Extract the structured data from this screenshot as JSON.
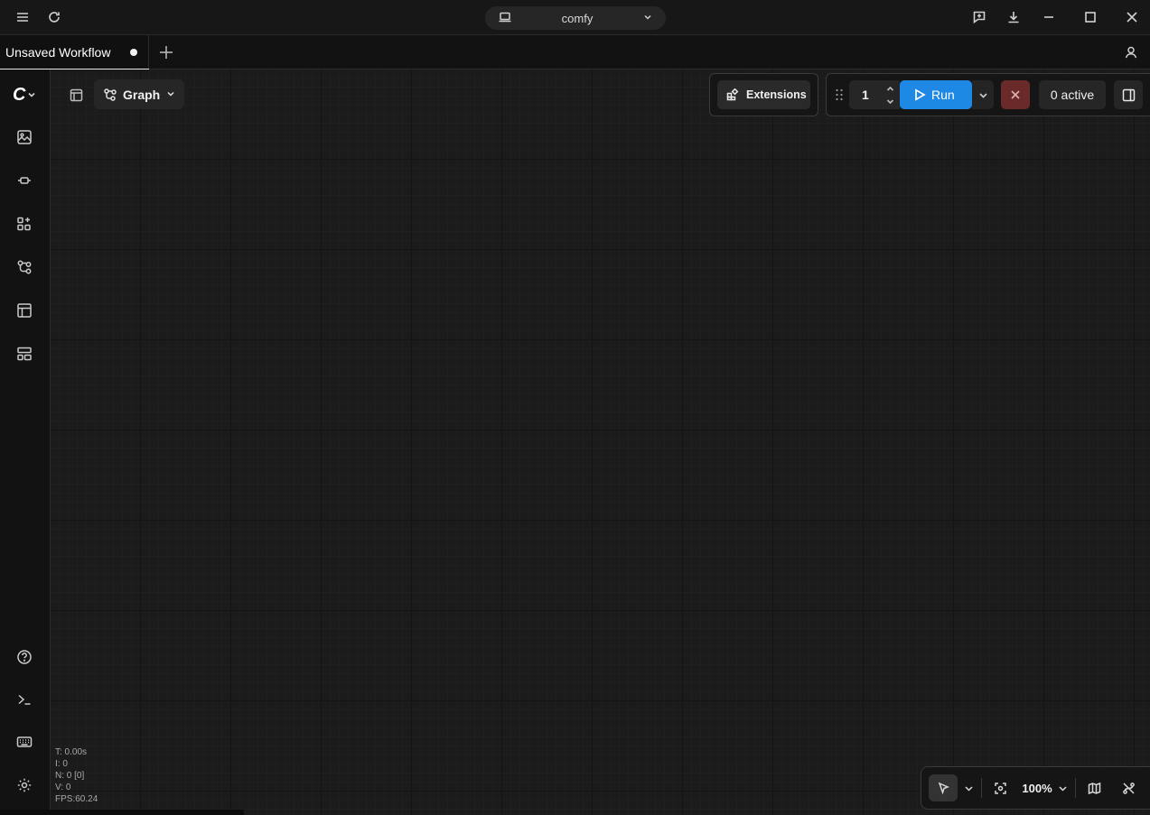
{
  "server": {
    "name": "comfy"
  },
  "tabs": {
    "active_title": "Unsaved Workflow"
  },
  "canvas": {
    "view_mode": "Graph",
    "extensions_label": "Extensions",
    "batch_count": "1",
    "run_label": "Run",
    "active_queue": "0 active",
    "zoom_level": "100%"
  },
  "stats": {
    "t": "T: 0.00s",
    "i": "I: 0",
    "n": "N: 0 [0]",
    "v": "V: 0",
    "fps": "FPS:60.24"
  },
  "colors": {
    "accent": "#1e88e5",
    "cancel": "#6b2a2a",
    "background": "#171717"
  },
  "icons": {
    "titlebar": [
      "menu-icon",
      "reload-icon",
      "laptop-icon",
      "chevron-down-icon",
      "feedback-icon",
      "download-icon",
      "minimize-icon",
      "maximize-icon",
      "close-icon"
    ],
    "sidebar": [
      "comfy-logo-icon",
      "images-icon",
      "models-icon",
      "node-library-icon",
      "workflows-icon",
      "templates-icon",
      "app-mode-icon",
      "help-icon",
      "terminal-icon",
      "keyboard-icon",
      "settings-icon"
    ]
  }
}
